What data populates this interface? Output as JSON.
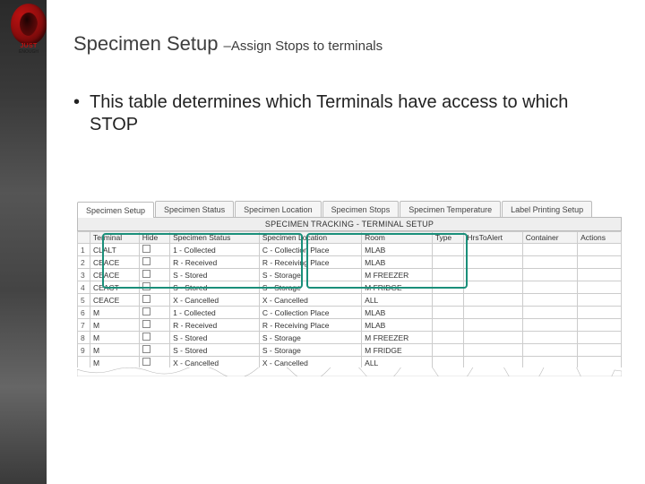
{
  "title_main": "Specimen Setup ",
  "title_sub": "–Assign Stops to terminals",
  "bullet_text": "This table determines which Terminals have access to which STOP",
  "logo_line1": "JUST",
  "logo_line2": "ENOUGH",
  "tabs": [
    {
      "label": "Specimen Setup"
    },
    {
      "label": "Specimen Status"
    },
    {
      "label": "Specimen Location"
    },
    {
      "label": "Specimen Stops"
    },
    {
      "label": "Specimen Temperature"
    },
    {
      "label": "Label Printing Setup"
    }
  ],
  "band_title": "SPECIMEN TRACKING - TERMINAL SETUP",
  "columns": [
    "",
    "Terminal",
    "Hide",
    "Specimen Status",
    "Specimen Location",
    "Room",
    "Type",
    "HrsToAlert",
    "Container",
    "Actions"
  ],
  "rows": [
    {
      "n": "1",
      "term": "CLALT",
      "status": "1 - Collected",
      "loc": "C - Collection Place",
      "room": "MLAB"
    },
    {
      "n": "2",
      "term": "CEACE",
      "status": "R - Received",
      "loc": "R - Receiving Place",
      "room": "MLAB"
    },
    {
      "n": "3",
      "term": "CEACE",
      "status": "S - Stored",
      "loc": "S - Storage",
      "room": "M FREEZER"
    },
    {
      "n": "4",
      "term": "CEACT",
      "status": "S - Stored",
      "loc": "S - Storage",
      "room": "M FRIDGE"
    },
    {
      "n": "5",
      "term": "CEACE",
      "status": "X - Cancelled",
      "loc": "X - Cancelled",
      "room": "ALL"
    },
    {
      "n": "6",
      "term": "M",
      "status": "1 - Collected",
      "loc": "C - Collection Place",
      "room": "MLAB"
    },
    {
      "n": "7",
      "term": "M",
      "status": "R - Received",
      "loc": "R - Receiving Place",
      "room": "MLAB"
    },
    {
      "n": "8",
      "term": "M",
      "status": "S - Stored",
      "loc": "S - Storage",
      "room": "M FREEZER"
    },
    {
      "n": "9",
      "term": "M",
      "status": "S - Stored",
      "loc": "S - Storage",
      "room": "M FRIDGE"
    },
    {
      "n": "",
      "term": "M",
      "status": "X - Cancelled",
      "loc": "X - Cancelled",
      "room": "ALL"
    }
  ]
}
